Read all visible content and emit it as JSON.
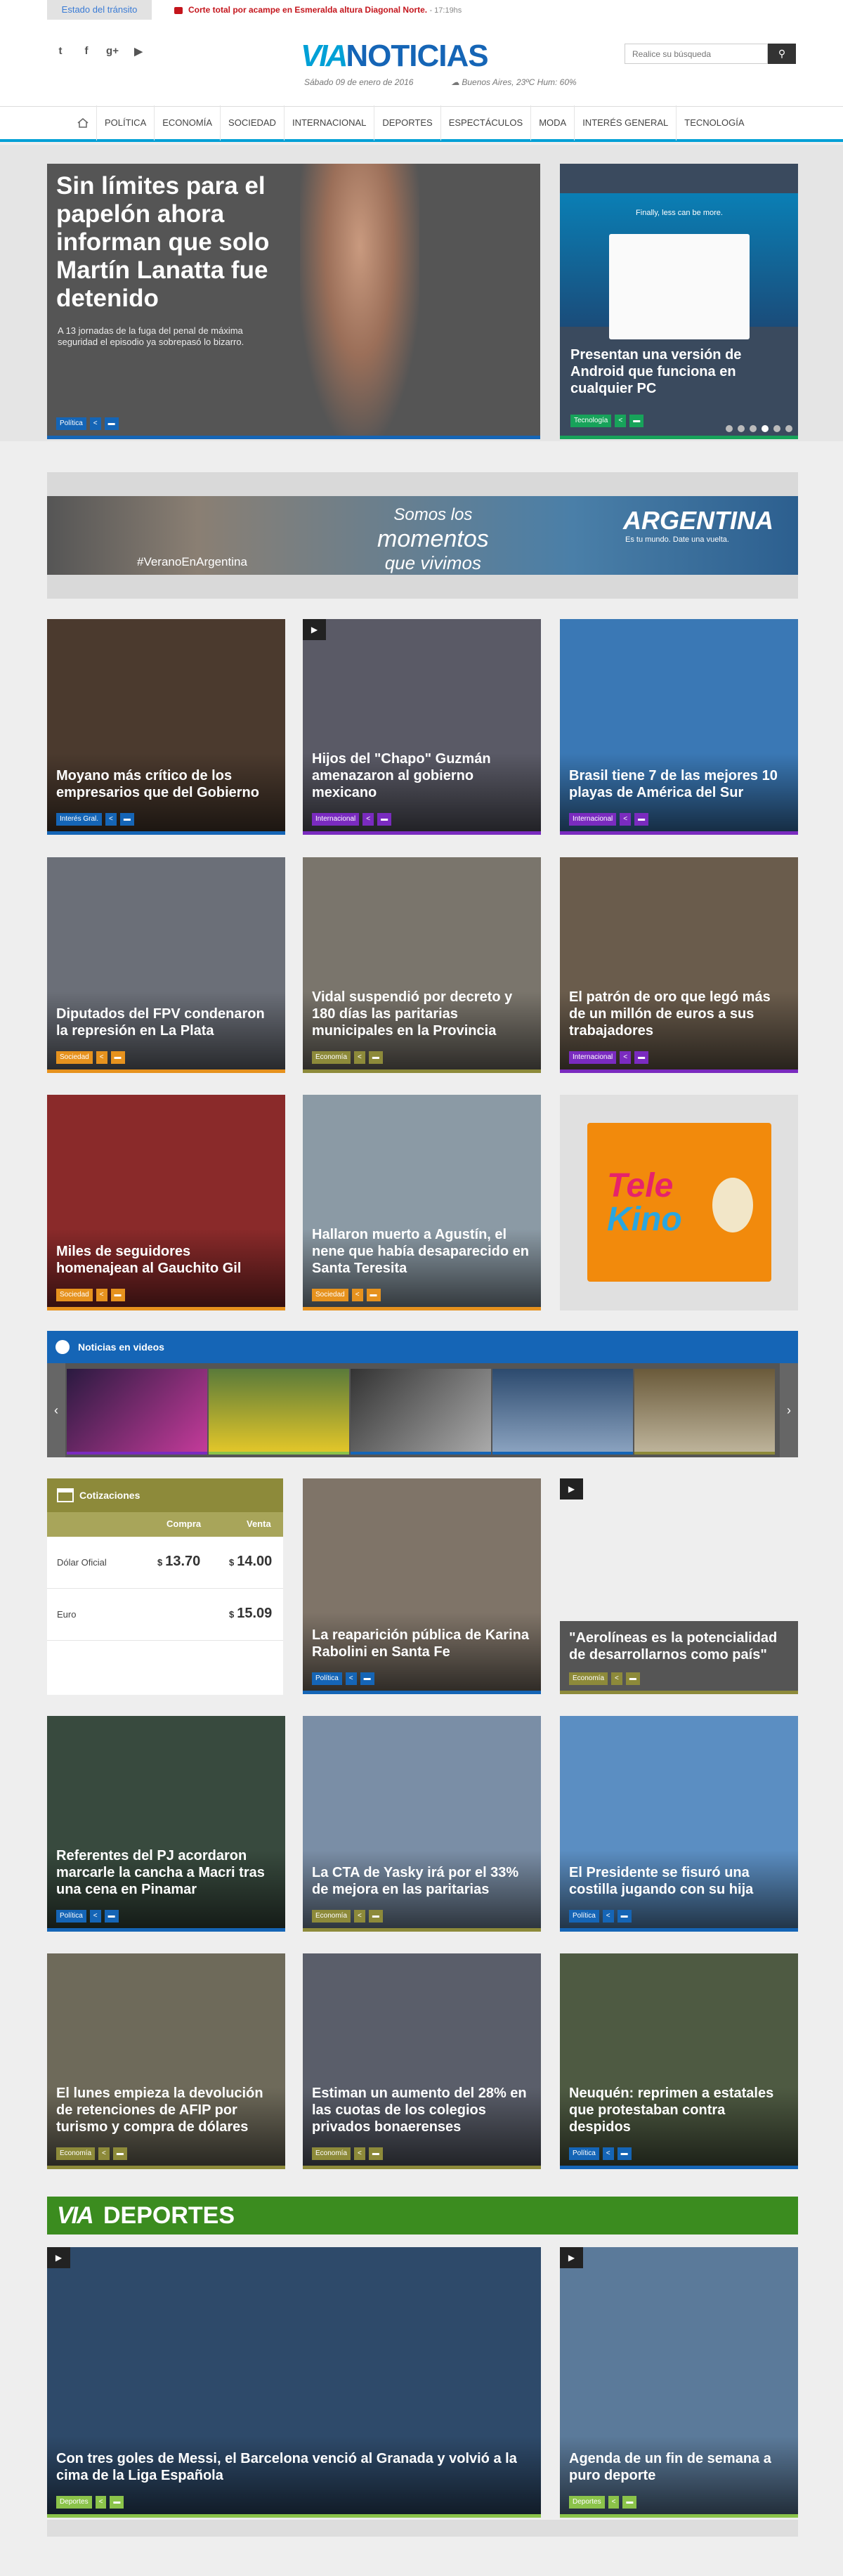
{
  "topbar": {
    "transit_label": "Estado del tránsito",
    "ticker_text": "Corte total por acampe en Esmeralda altura Diagonal Norte.",
    "ticker_time": "- 17:19hs"
  },
  "header": {
    "social": [
      "twitter-icon",
      "facebook-icon",
      "google-plus-icon",
      "youtube-icon"
    ],
    "logo_via": "VIA",
    "logo_noticias": "NOTICIAS",
    "date": "Sábado 09 de enero de 2016",
    "weather": "Buenos Aires, 23ºC  Hum: 60%",
    "search_placeholder": "Realice su búsqueda"
  },
  "nav": [
    "POLÍTICA",
    "ECONOMÍA",
    "SOCIEDAD",
    "INTERNACIONAL",
    "DEPORTES",
    "ESPECTÁCULOS",
    "MODA",
    "INTERÉS GENERAL",
    "TECNOLOGÍA"
  ],
  "hero": {
    "main": {
      "title": "Sin límites para el papelón ahora informan que solo Martín Lanatta fue detenido",
      "subtitle": "A 13 jornadas de la fuga del penal de máxima seguridad el episodio ya sobrepasó lo bizarro.",
      "section": "Política",
      "color": "#1565b6"
    },
    "side": {
      "title": "Presentan una versión de Android que funciona en cualquier PC",
      "section": "Tecnología",
      "color": "#17a35a",
      "screen_text": "Finally, less can be more.",
      "slide": 4,
      "slides": 6
    }
  },
  "banner": {
    "tag": "#VeranoEnArgentina",
    "slogan_1": "Somos los",
    "slogan_2": "momentos",
    "slogan_3": "que vivimos",
    "country": "ARGENTINA",
    "country_sub": "Es tu mundo. Date una vuelta."
  },
  "grid1": [
    {
      "title": "Moyano más crítico de los empresarios que del Gobierno",
      "section": "Interés Gral.",
      "color": "#1565b6",
      "bg": "#4b3a2e",
      "video": false
    },
    {
      "title": "Hijos del \"Chapo\" Guzmán amenazaron al gobierno mexicano",
      "section": "Internacional",
      "color": "#7a2bbf",
      "bg": "#5a5a66",
      "video": true
    },
    {
      "title": "Brasil tiene 7 de las mejores 10 playas de América del Sur",
      "section": "Internacional",
      "color": "#7a2bbf",
      "bg": "#3a78b5",
      "video": false
    },
    {
      "title": "Diputados del FPV condenaron la represión en La Plata",
      "section": "Sociedad",
      "color": "#e6921e",
      "bg": "#6b6f78",
      "video": false
    },
    {
      "title": "Vidal suspendió por decreto y 180 días las paritarias municipales en la Provincia",
      "section": "Economía",
      "color": "#8d8a3a",
      "bg": "#7a756c",
      "video": false
    },
    {
      "title": "El patrón de oro que legó más de un millón de euros a sus trabajadores",
      "section": "Internacional",
      "color": "#7a2bbf",
      "bg": "#6a5c4c",
      "video": false
    },
    {
      "title": "Miles de seguidores homenajean al Gauchito Gil",
      "section": "Sociedad",
      "color": "#e6921e",
      "bg": "#8a2a2a",
      "video": false
    },
    {
      "title": "Hallaron muerto a Agustín, el nene que había desaparecido en Santa Teresita",
      "section": "Sociedad",
      "color": "#e6921e",
      "bg": "#8b9aa5",
      "video": false
    }
  ],
  "ad": {
    "brand_1": "Tele",
    "brand_2": "Kino"
  },
  "videos": {
    "title": "Noticias en videos"
  },
  "quotes": {
    "title": "Cotizaciones",
    "buy": "Compra",
    "sell": "Venta",
    "rows": [
      {
        "label": "Dólar Oficial",
        "buy_cur": "$",
        "buy": "13.70",
        "sell_cur": "$",
        "sell": "14.00"
      },
      {
        "label": "Euro",
        "buy_cur": "",
        "buy": "",
        "sell_cur": "$",
        "sell": "15.09"
      }
    ]
  },
  "grid2": [
    {
      "title": "La reaparición pública de Karina Rabolini en Santa Fe",
      "section": "Política",
      "color": "#1565b6",
      "bg": "#7f7468",
      "video": false
    },
    {
      "title": "\"Aerolíneas es la potencialidad de desarrollarnos como país\"",
      "section": "Economía",
      "color": "#8d8a3a",
      "bg": "#eeeeee",
      "video": true
    },
    {
      "title": "Referentes del PJ acordaron marcarle la cancha a Macri tras una cena en Pinamar",
      "section": "Política",
      "color": "#1565b6",
      "bg": "#384a3e",
      "video": false
    },
    {
      "title": "La CTA de Yasky irá por el 33% de mejora en las paritarias",
      "section": "Economía",
      "color": "#8d8a3a",
      "bg": "#7a8ea6",
      "video": false
    },
    {
      "title": "El Presidente se fisuró una costilla jugando con su hija",
      "section": "Política",
      "color": "#1565b6",
      "bg": "#5b8ec2",
      "video": false
    },
    {
      "title": "El lunes empieza la devolución de retenciones de AFIP por turismo y compra de dólares",
      "section": "Economía",
      "color": "#8d8a3a",
      "bg": "#6e6a5a",
      "video": false
    },
    {
      "title": "Estiman un aumento del 28% en las cuotas de los colegios privados bonaerenses",
      "section": "Economía",
      "color": "#8d8a3a",
      "bg": "#5a5e6a",
      "video": false
    },
    {
      "title": "Neuquén: reprimen a estatales que protestaban contra despidos",
      "section": "Política",
      "color": "#1565b6",
      "bg": "#4e5a42",
      "video": false
    }
  ],
  "deportes": {
    "logo_via": "VIA",
    "logo_name": "DEPORTES",
    "items": [
      {
        "title": "Con tres goles de Messi, el Barcelona venció al Granada y volvió a la cima de la Liga Española",
        "section": "Deportes",
        "color": "#8bc34a",
        "bg": "#2e4a6a",
        "video": true
      },
      {
        "title": "Agenda de un fin de semana a puro deporte",
        "section": "Deportes",
        "color": "#8bc34a",
        "bg": "#5b7a9a",
        "video": true
      }
    ]
  }
}
